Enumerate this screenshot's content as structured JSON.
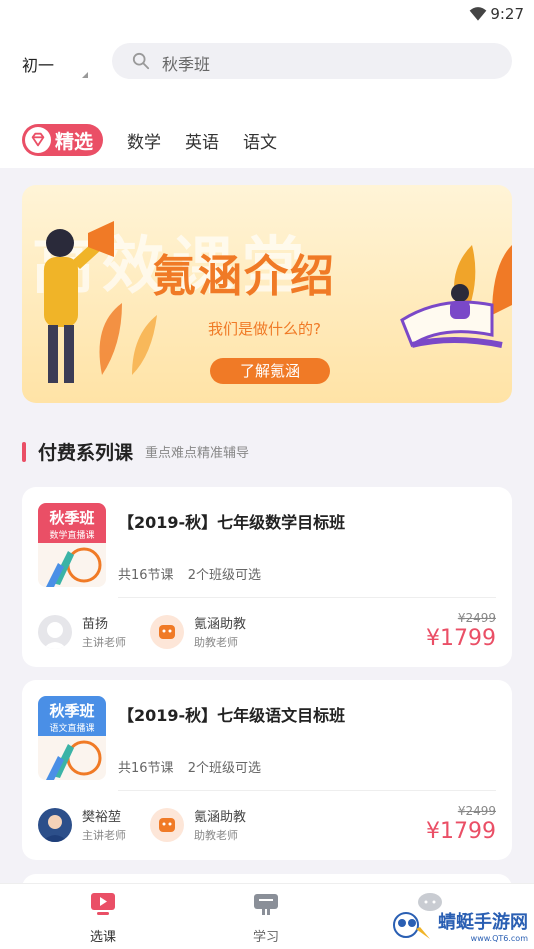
{
  "status_bar": {
    "time": "9:27",
    "wifi_icon": "wifi-icon"
  },
  "header": {
    "grade": "初一",
    "search_placeholder": "秋季班",
    "search_icon": "search-icon"
  },
  "tabs": {
    "featured": "精选",
    "items": [
      "数学",
      "英语",
      "语文"
    ]
  },
  "banner": {
    "background_text": "高效课堂",
    "title": "氪涵介绍",
    "subtitle": "我们是做什么的?",
    "cta": "了解氪涵"
  },
  "section": {
    "title": "付费系列课",
    "subtitle": "重点难点精准辅导"
  },
  "courses": [
    {
      "cover_title": "秋季班",
      "cover_subtitle": "数学直播课",
      "cover_color": "#ea4f66",
      "title": "【2019-秋】七年级数学目标班",
      "lessons": "共16节课",
      "classes": "2个班级可选",
      "teacher_name": "苗扬",
      "teacher_role": "主讲老师",
      "assistant_name": "氪涵助教",
      "assistant_role": "助教老师",
      "original_price": "¥2499",
      "price": "¥1799"
    },
    {
      "cover_title": "秋季班",
      "cover_subtitle": "语文直播课",
      "cover_color": "#4a8fe6",
      "title": "【2019-秋】七年级语文目标班",
      "lessons": "共16节课",
      "classes": "2个班级可选",
      "teacher_name": "樊裕堃",
      "teacher_role": "主讲老师",
      "assistant_name": "氪涵助教",
      "assistant_role": "助教老师",
      "original_price": "¥2499",
      "price": "¥1799"
    }
  ],
  "bottom_nav": [
    {
      "label": "选课",
      "icon": "play-course-icon",
      "active": true
    },
    {
      "label": "学习",
      "icon": "study-icon",
      "active": false
    },
    {
      "label": "",
      "icon": "chat-icon",
      "active": false
    }
  ],
  "watermark": {
    "text": "蜻蜓手游网",
    "url": "www.QT6.com"
  },
  "colors": {
    "accent": "#ea4f66",
    "banner_orange": "#f07a26",
    "blue": "#4a8fe6"
  }
}
